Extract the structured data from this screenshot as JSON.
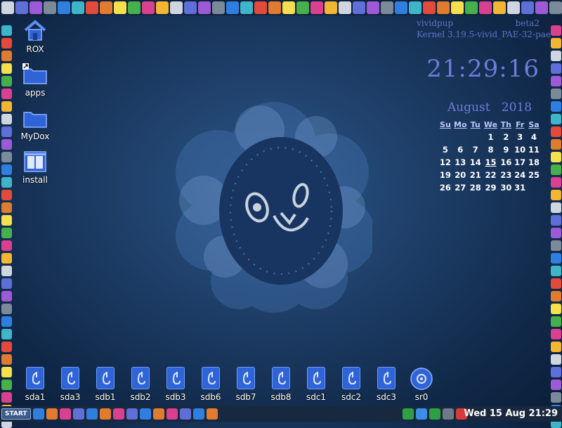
{
  "desktop_icons": [
    {
      "label": "ROX",
      "icon": "home-icon"
    },
    {
      "label": "apps",
      "icon": "folder-icon"
    },
    {
      "label": "MyDox",
      "icon": "folder-icon"
    },
    {
      "label": "install",
      "icon": "install-icon"
    }
  ],
  "drives": [
    {
      "label": "sda1"
    },
    {
      "label": "sda3"
    },
    {
      "label": "sdb1"
    },
    {
      "label": "sdb2"
    },
    {
      "label": "sdb3"
    },
    {
      "label": "sdb6"
    },
    {
      "label": "sdb7"
    },
    {
      "label": "sdb8"
    },
    {
      "label": "sdc1"
    },
    {
      "label": "sdc2"
    },
    {
      "label": "sdc3"
    },
    {
      "label": "sr0"
    }
  ],
  "system_info": {
    "distro": "vividpup",
    "version": "beta2",
    "kernel_label": "Kernel",
    "kernel": "3.19.5-vivid_PAE-32-pae"
  },
  "clock": {
    "time": "21:29:16"
  },
  "calendar": {
    "month": "August",
    "year": "2018",
    "weekdays": [
      "Su",
      "Mo",
      "Tu",
      "We",
      "Th",
      "Fr",
      "Sa"
    ],
    "weeks": [
      [
        "",
        "",
        "",
        "1",
        "2",
        "3",
        "4"
      ],
      [
        "5",
        "6",
        "7",
        "8",
        "9",
        "10",
        "11"
      ],
      [
        "12",
        "13",
        "14",
        "15",
        "16",
        "17",
        "18"
      ],
      [
        "19",
        "20",
        "21",
        "22",
        "23",
        "24",
        "25"
      ],
      [
        "26",
        "27",
        "28",
        "29",
        "30",
        "31",
        ""
      ]
    ],
    "today": "15"
  },
  "taskbar": {
    "start_label": "START",
    "datetime": "Wed 15 Aug 21:29"
  },
  "colors": {
    "accent": "#6f7bd8",
    "drive_blue": "#2f63d8"
  }
}
